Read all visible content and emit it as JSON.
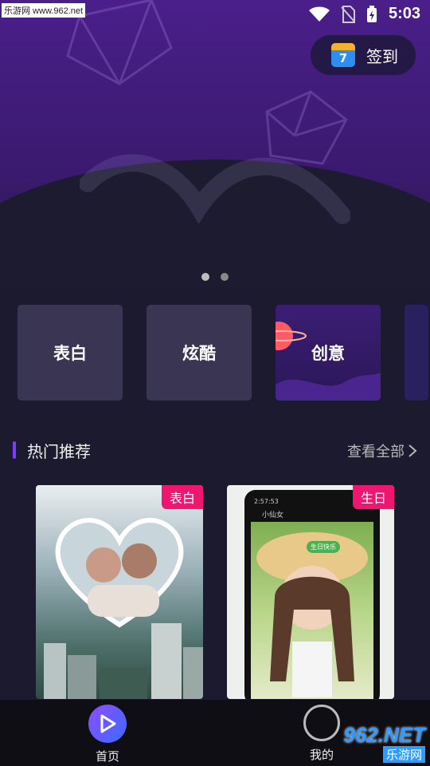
{
  "status": {
    "watermark": "乐游网 www.962.net",
    "time": "5:03"
  },
  "signin": {
    "label": "签到",
    "calendar_day": "7"
  },
  "banner": {
    "dots": 2,
    "active_dot": 0
  },
  "categories": [
    {
      "label": "表白"
    },
    {
      "label": "炫酷"
    },
    {
      "label": "创意"
    }
  ],
  "section": {
    "title": "热门推荐",
    "more": "查看全部"
  },
  "cards": [
    {
      "tag": "表白"
    },
    {
      "tag": "生日"
    }
  ],
  "phone_in_card": {
    "header_time": "2:57:53",
    "chat_title": "小仙女",
    "sticker": "生日快乐"
  },
  "nav": {
    "home": "首页",
    "me": "我的"
  },
  "watermark_bottom": {
    "big": "962.NET",
    "small": "乐游网"
  },
  "colors": {
    "accent": "#7a3cff",
    "tag": "#f0156e",
    "bg": "#1c1a2e"
  }
}
